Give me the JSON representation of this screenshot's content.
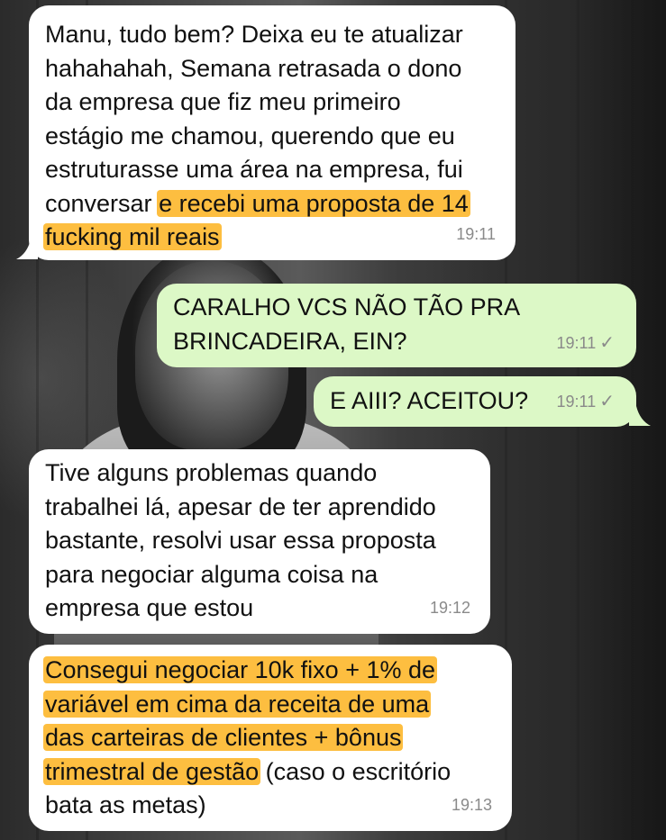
{
  "chat": {
    "messages": [
      {
        "direction": "incoming",
        "lines": [
          [
            {
              "t": "Manu, tudo bem? Deixa eu te atualizar"
            }
          ],
          [
            {
              "t": "hahahahah, Semana retrasada o dono"
            }
          ],
          [
            {
              "t": "da empresa que fiz meu primeiro"
            }
          ],
          [
            {
              "t": "estágio me chamou, querendo que eu"
            }
          ],
          [
            {
              "t": "estruturasse uma área na empresa, fui"
            }
          ],
          [
            {
              "t": "conversar "
            },
            {
              "t": "e recebi uma proposta de 14",
              "hl": true
            }
          ],
          [
            {
              "t": "fucking mil reais",
              "hl": true
            }
          ]
        ],
        "time": "19:11"
      },
      {
        "direction": "outgoing",
        "lines": [
          [
            {
              "t": "CARALHO VCS NÃO TÃO PRA"
            }
          ],
          [
            {
              "t": "BRINCADEIRA, EIN?"
            }
          ]
        ],
        "time": "19:11",
        "status_icon": "single-check-icon"
      },
      {
        "direction": "outgoing",
        "lines": [
          [
            {
              "t": "E AIII? ACEITOU?"
            }
          ]
        ],
        "time": "19:11",
        "status_icon": "single-check-icon"
      },
      {
        "direction": "incoming",
        "lines": [
          [
            {
              "t": "Tive alguns problemas quando"
            }
          ],
          [
            {
              "t": "trabalhei lá, apesar de ter aprendido"
            }
          ],
          [
            {
              "t": "bastante, resolvi usar essa proposta"
            }
          ],
          [
            {
              "t": "para negociar alguma coisa na"
            }
          ],
          [
            {
              "t": "empresa que estou"
            }
          ]
        ],
        "time": "19:12"
      },
      {
        "direction": "incoming",
        "lines": [
          [
            {
              "t": "Consegui negociar 10k fixo + 1% de",
              "hl": true
            }
          ],
          [
            {
              "t": "variável em cima da receita de uma",
              "hl": true
            }
          ],
          [
            {
              "t": "das carteiras de clientes + bônus",
              "hl": true
            }
          ],
          [
            {
              "t": "trimestral de gestão",
              "hl": true
            },
            {
              "t": " (caso o escritório"
            }
          ],
          [
            {
              "t": "bata as metas)"
            }
          ]
        ],
        "time": "19:13"
      }
    ]
  },
  "colors": {
    "incoming_bubble": "#ffffff",
    "outgoing_bubble": "#dcf8c6",
    "highlight": "#fdb016"
  }
}
